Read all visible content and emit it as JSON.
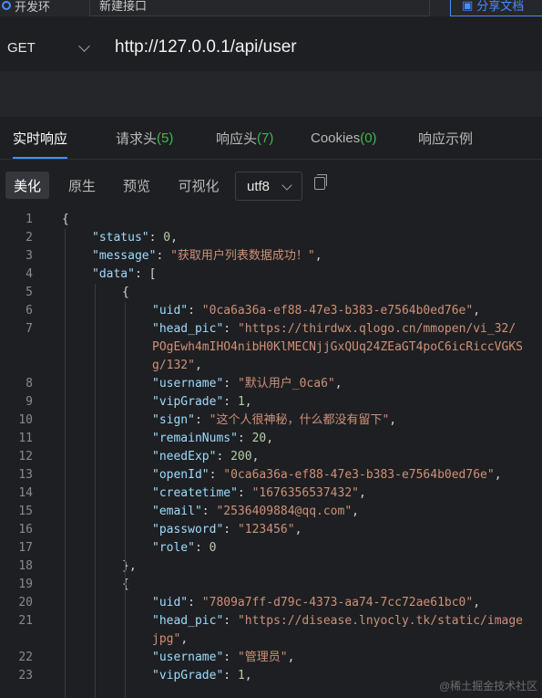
{
  "topbar": {
    "env_label": "开发环",
    "tab_name": "新建接口",
    "share_label": "分享文档"
  },
  "request": {
    "method": "GET",
    "url": "http://127.0.0.1/api/user"
  },
  "response_tabs": [
    {
      "label": "实时响应",
      "count": ""
    },
    {
      "label": "请求头",
      "count": "(5)"
    },
    {
      "label": "响应头",
      "count": "(7)"
    },
    {
      "label": "Cookies",
      "count": "(0)"
    },
    {
      "label": "响应示例",
      "count": ""
    }
  ],
  "view_modes": [
    "美化",
    "原生",
    "预览",
    "可视化"
  ],
  "encoding": "utf8",
  "code_lines": [
    {
      "n": "1",
      "indent": 0,
      "tokens": [
        {
          "t": "p",
          "v": "{"
        }
      ]
    },
    {
      "n": "2",
      "indent": 1,
      "tokens": [
        {
          "t": "k",
          "v": "\"status\""
        },
        {
          "t": "p",
          "v": ": "
        },
        {
          "t": "n",
          "v": "0"
        },
        {
          "t": "p",
          "v": ","
        }
      ]
    },
    {
      "n": "3",
      "indent": 1,
      "tokens": [
        {
          "t": "k",
          "v": "\"message\""
        },
        {
          "t": "p",
          "v": ": "
        },
        {
          "t": "s",
          "v": "\"获取用户列表数据成功！\""
        },
        {
          "t": "p",
          "v": ","
        }
      ]
    },
    {
      "n": "4",
      "indent": 1,
      "tokens": [
        {
          "t": "k",
          "v": "\"data\""
        },
        {
          "t": "p",
          "v": ": ["
        }
      ]
    },
    {
      "n": "5",
      "indent": 2,
      "tokens": [
        {
          "t": "p",
          "v": "{"
        }
      ]
    },
    {
      "n": "6",
      "indent": 3,
      "tokens": [
        {
          "t": "k",
          "v": "\"uid\""
        },
        {
          "t": "p",
          "v": ": "
        },
        {
          "t": "s",
          "v": "\"0ca6a36a-ef88-47e3-b383-e7564b0ed76e\""
        },
        {
          "t": "p",
          "v": ","
        }
      ]
    },
    {
      "n": "7",
      "indent": 3,
      "tokens": [
        {
          "t": "k",
          "v": "\"head_pic\""
        },
        {
          "t": "p",
          "v": ": "
        },
        {
          "t": "s",
          "v": "\"https://thirdwx.qlogo.cn/mmopen/vi_32/"
        }
      ]
    },
    {
      "n": "",
      "indent": 3,
      "tokens": [
        {
          "t": "s",
          "v": "POgEwh4mIHO4nibH0KlMECNjjGxQUq24ZEaGT4poC6icRiccVGKS"
        }
      ]
    },
    {
      "n": "",
      "indent": 3,
      "tokens": [
        {
          "t": "s",
          "v": "g/132\""
        },
        {
          "t": "p",
          "v": ","
        }
      ]
    },
    {
      "n": "8",
      "indent": 3,
      "tokens": [
        {
          "t": "k",
          "v": "\"username\""
        },
        {
          "t": "p",
          "v": ": "
        },
        {
          "t": "s",
          "v": "\"默认用户_0ca6\""
        },
        {
          "t": "p",
          "v": ","
        }
      ]
    },
    {
      "n": "9",
      "indent": 3,
      "tokens": [
        {
          "t": "k",
          "v": "\"vipGrade\""
        },
        {
          "t": "p",
          "v": ": "
        },
        {
          "t": "n",
          "v": "1"
        },
        {
          "t": "p",
          "v": ","
        }
      ]
    },
    {
      "n": "10",
      "indent": 3,
      "tokens": [
        {
          "t": "k",
          "v": "\"sign\""
        },
        {
          "t": "p",
          "v": ": "
        },
        {
          "t": "s",
          "v": "\"这个人很神秘，什么都没有留下\""
        },
        {
          "t": "p",
          "v": ","
        }
      ]
    },
    {
      "n": "11",
      "indent": 3,
      "tokens": [
        {
          "t": "k",
          "v": "\"remainNums\""
        },
        {
          "t": "p",
          "v": ": "
        },
        {
          "t": "n",
          "v": "20"
        },
        {
          "t": "p",
          "v": ","
        }
      ]
    },
    {
      "n": "12",
      "indent": 3,
      "tokens": [
        {
          "t": "k",
          "v": "\"needExp\""
        },
        {
          "t": "p",
          "v": ": "
        },
        {
          "t": "n",
          "v": "200"
        },
        {
          "t": "p",
          "v": ","
        }
      ]
    },
    {
      "n": "13",
      "indent": 3,
      "tokens": [
        {
          "t": "k",
          "v": "\"openId\""
        },
        {
          "t": "p",
          "v": ": "
        },
        {
          "t": "s",
          "v": "\"0ca6a36a-ef88-47e3-b383-e7564b0ed76e\""
        },
        {
          "t": "p",
          "v": ","
        }
      ]
    },
    {
      "n": "14",
      "indent": 3,
      "tokens": [
        {
          "t": "k",
          "v": "\"createtime\""
        },
        {
          "t": "p",
          "v": ": "
        },
        {
          "t": "s",
          "v": "\"1676356537432\""
        },
        {
          "t": "p",
          "v": ","
        }
      ]
    },
    {
      "n": "15",
      "indent": 3,
      "tokens": [
        {
          "t": "k",
          "v": "\"email\""
        },
        {
          "t": "p",
          "v": ": "
        },
        {
          "t": "s",
          "v": "\"2536409884@qq.com\""
        },
        {
          "t": "p",
          "v": ","
        }
      ]
    },
    {
      "n": "16",
      "indent": 3,
      "tokens": [
        {
          "t": "k",
          "v": "\"password\""
        },
        {
          "t": "p",
          "v": ": "
        },
        {
          "t": "s",
          "v": "\"123456\""
        },
        {
          "t": "p",
          "v": ","
        }
      ]
    },
    {
      "n": "17",
      "indent": 3,
      "tokens": [
        {
          "t": "k",
          "v": "\"role\""
        },
        {
          "t": "p",
          "v": ": "
        },
        {
          "t": "n",
          "v": "0"
        }
      ]
    },
    {
      "n": "18",
      "indent": 2,
      "tokens": [
        {
          "t": "p",
          "v": "},"
        }
      ]
    },
    {
      "n": "19",
      "indent": 2,
      "tokens": [
        {
          "t": "p",
          "v": "{"
        }
      ]
    },
    {
      "n": "20",
      "indent": 3,
      "tokens": [
        {
          "t": "k",
          "v": "\"uid\""
        },
        {
          "t": "p",
          "v": ": "
        },
        {
          "t": "s",
          "v": "\"7809a7ff-d79c-4373-aa74-7cc72ae61bc0\""
        },
        {
          "t": "p",
          "v": ","
        }
      ]
    },
    {
      "n": "21",
      "indent": 3,
      "tokens": [
        {
          "t": "k",
          "v": "\"head_pic\""
        },
        {
          "t": "p",
          "v": ": "
        },
        {
          "t": "s",
          "v": "\"https://disease.lnyocly.tk/static/image"
        }
      ]
    },
    {
      "n": "",
      "indent": 3,
      "tokens": [
        {
          "t": "s",
          "v": "jpg\""
        },
        {
          "t": "p",
          "v": ","
        }
      ]
    },
    {
      "n": "22",
      "indent": 3,
      "tokens": [
        {
          "t": "k",
          "v": "\"username\""
        },
        {
          "t": "p",
          "v": ": "
        },
        {
          "t": "s",
          "v": "\"管理员\""
        },
        {
          "t": "p",
          "v": ","
        }
      ]
    },
    {
      "n": "23",
      "indent": 3,
      "tokens": [
        {
          "t": "k",
          "v": "\"vipGrade\""
        },
        {
          "t": "p",
          "v": ": "
        },
        {
          "t": "n",
          "v": "1"
        },
        {
          "t": "p",
          "v": ","
        }
      ]
    }
  ],
  "watermark": "@稀土掘金技术社区",
  "colors": {
    "accent": "#4a8cff",
    "count": "#3fb950",
    "key": "#9cdcfe",
    "string": "#ce9178",
    "number": "#b5cea8"
  },
  "icons": [
    "env-dot-icon",
    "chevron-down-icon",
    "share-icon",
    "copy-icon"
  ]
}
